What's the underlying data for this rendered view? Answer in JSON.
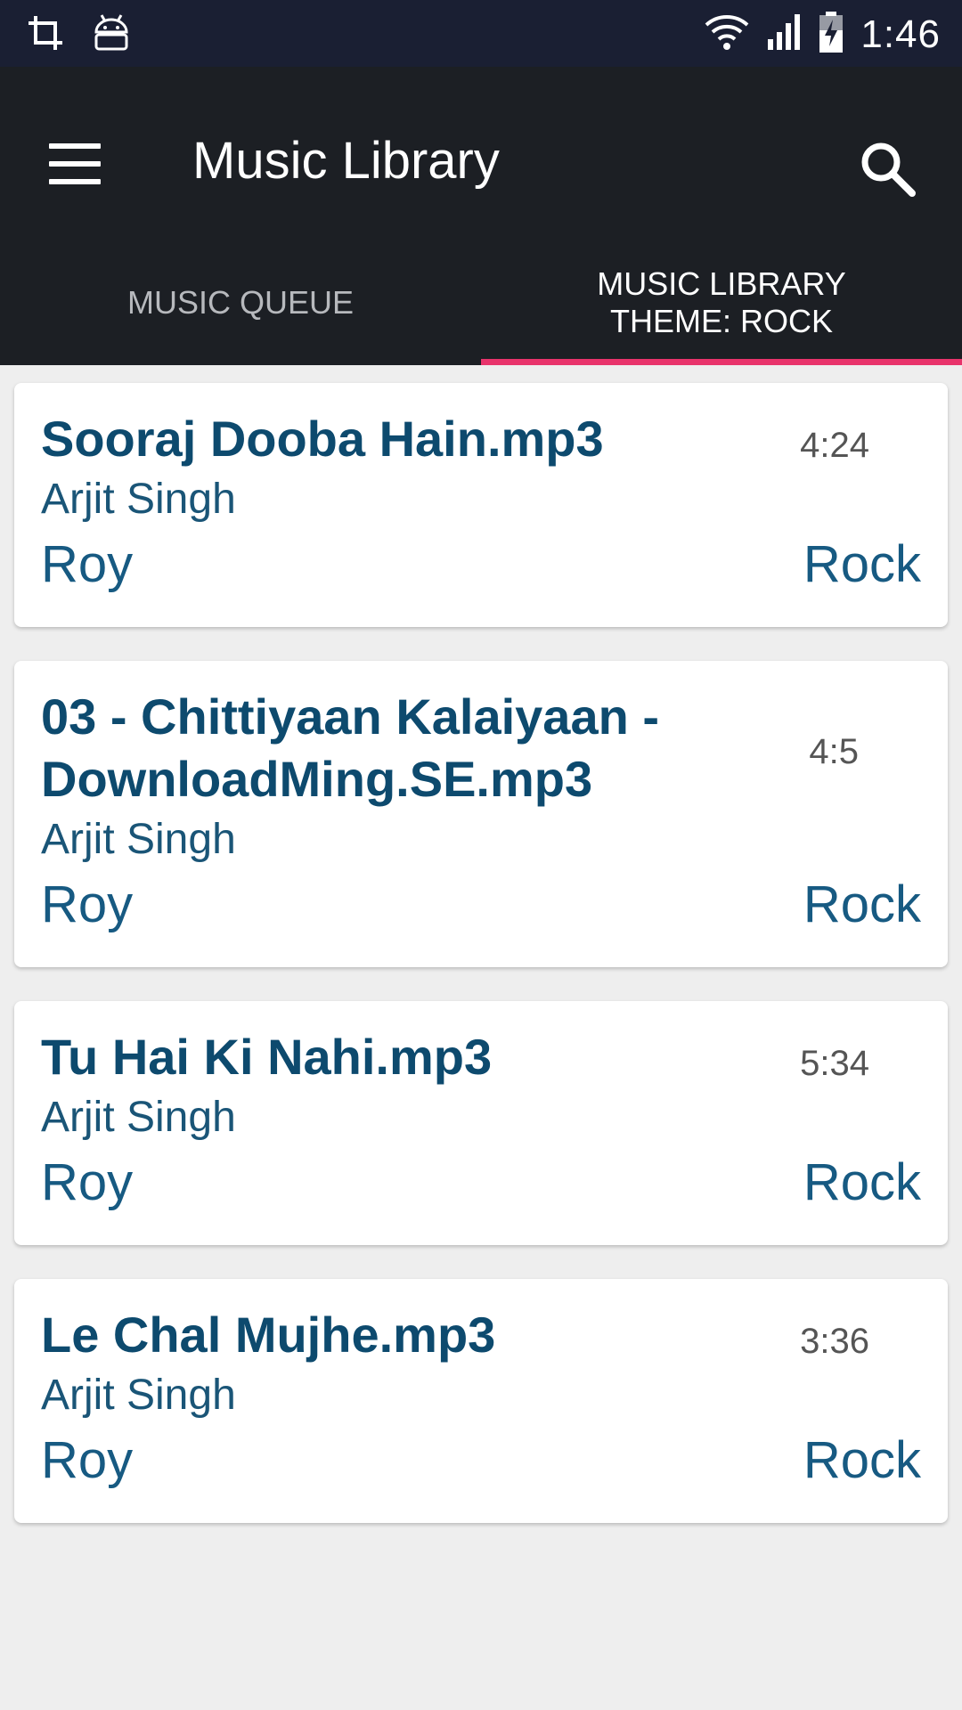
{
  "status_bar": {
    "time": "1:46",
    "icons_left": [
      "crop-icon",
      "android-icon"
    ],
    "icons_right": [
      "wifi-icon",
      "signal-icon",
      "battery-charging-icon"
    ]
  },
  "app_bar": {
    "title": "Music Library",
    "menu_icon": "menu-icon",
    "search_icon": "search-icon"
  },
  "tabs": [
    {
      "label": "MUSIC QUEUE",
      "active": false
    },
    {
      "label_line1": "MUSIC LIBRARY",
      "label_line2": "THEME: ROCK",
      "active": true
    }
  ],
  "colors": {
    "status_bar": "#1a1f33",
    "app_bar": "#1c1f24",
    "tab_indicator": "#e8336b",
    "title_text": "#0d4a6e",
    "background": "#eeeeee"
  },
  "songs": [
    {
      "title": "Sooraj Dooba Hain.mp3",
      "duration": "4:24",
      "artist": "Arjit Singh",
      "album": "Roy",
      "genre": "Rock"
    },
    {
      "title": "03 - Chittiyaan Kalaiyaan - DownloadMing.SE.mp3",
      "duration": "4:5",
      "artist": "Arjit Singh",
      "album": "Roy",
      "genre": "Rock"
    },
    {
      "title": "Tu Hai Ki Nahi.mp3",
      "duration": "5:34",
      "artist": "Arjit Singh",
      "album": "Roy",
      "genre": "Rock"
    },
    {
      "title": "Le Chal Mujhe.mp3",
      "duration": "3:36",
      "artist": "Arjit Singh",
      "album": "Roy",
      "genre": "Rock"
    }
  ]
}
